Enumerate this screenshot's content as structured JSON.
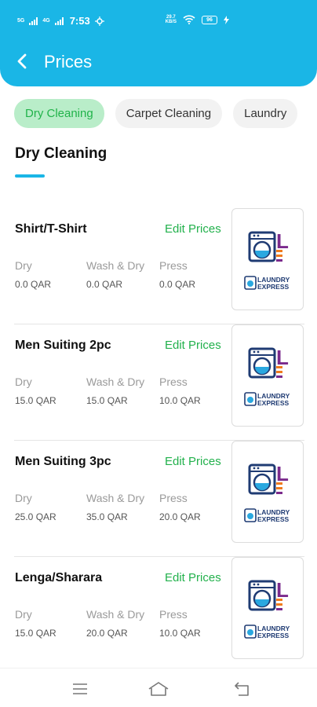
{
  "status": {
    "network": "4G",
    "network2": "5G",
    "time": "7:53",
    "speed_top": "29.7",
    "speed_bottom": "KB/S",
    "battery": "96"
  },
  "header": {
    "title": "Prices"
  },
  "categories": [
    "Dry Cleaning",
    "Carpet Cleaning",
    "Laundry"
  ],
  "section": {
    "title": "Dry Cleaning"
  },
  "column_labels": {
    "dry": "Dry",
    "wash_dry": "Wash & Dry",
    "press": "Press"
  },
  "edit_label": "Edit Prices",
  "items": [
    {
      "name": "Shirt/T-Shirt",
      "dry": "0.0 QAR",
      "wash_dry": "0.0 QAR",
      "press": "0.0 QAR"
    },
    {
      "name": "Men Suiting 2pc",
      "dry": "15.0 QAR",
      "wash_dry": "15.0 QAR",
      "press": "10.0 QAR"
    },
    {
      "name": "Men Suiting 3pc",
      "dry": "25.0 QAR",
      "wash_dry": "35.0 QAR",
      "press": "20.0 QAR"
    },
    {
      "name": "Lenga/Sharara",
      "dry": "15.0 QAR",
      "wash_dry": "20.0 QAR",
      "press": "10.0 QAR"
    }
  ],
  "logo": {
    "line1": "LAUNDRY",
    "line2": "EXPRESS",
    "letter": "L"
  },
  "colors": {
    "accent": "#1ab6e6",
    "green": "#22b14c",
    "chip_active_bg": "#b9edc9"
  },
  "icons": {
    "back": "arrow-back-icon",
    "menu": "menu-icon",
    "home": "home-icon",
    "return": "return-icon"
  }
}
